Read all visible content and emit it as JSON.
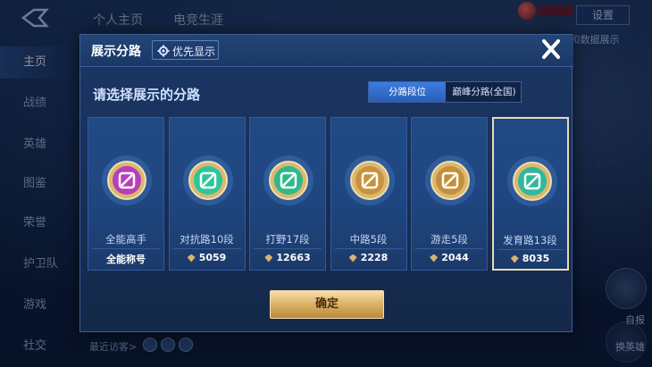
{
  "background": {
    "top_tabs": [
      "个人主页",
      "电竞生涯"
    ],
    "top_button_label": "设置",
    "data_show_label": "和数据展示",
    "sidebar": [
      "主页",
      "战绩",
      "英雄",
      "图鉴",
      "荣誉",
      "护卫队",
      "游戏",
      "社交"
    ],
    "recent_visitors_label": "最近访客>",
    "right_labels": [
      "自报",
      "换英雄"
    ]
  },
  "modal": {
    "title": "展示分路",
    "priority_label": "优先显示",
    "prompt": "请选择展示的分路",
    "toggle": {
      "active": "分路段位",
      "inactive": "巅峰分路(全国)"
    },
    "cards": [
      {
        "name": "全能高手",
        "score": "全能称号",
        "selected": false,
        "emblem_color": "#b640b8"
      },
      {
        "name": "对抗路10段",
        "score": "5059",
        "selected": false,
        "emblem_color": "#2cc69a"
      },
      {
        "name": "打野17段",
        "score": "12663",
        "selected": false,
        "emblem_color": "#2fb88b"
      },
      {
        "name": "中路5段",
        "score": "2228",
        "selected": false,
        "emblem_color": "#c8923e"
      },
      {
        "name": "游走5段",
        "score": "2044",
        "selected": false,
        "emblem_color": "#c58f3a"
      },
      {
        "name": "发育路13段",
        "score": "8035",
        "selected": true,
        "emblem_color": "#30b89a"
      }
    ],
    "confirm_label": "确定"
  }
}
